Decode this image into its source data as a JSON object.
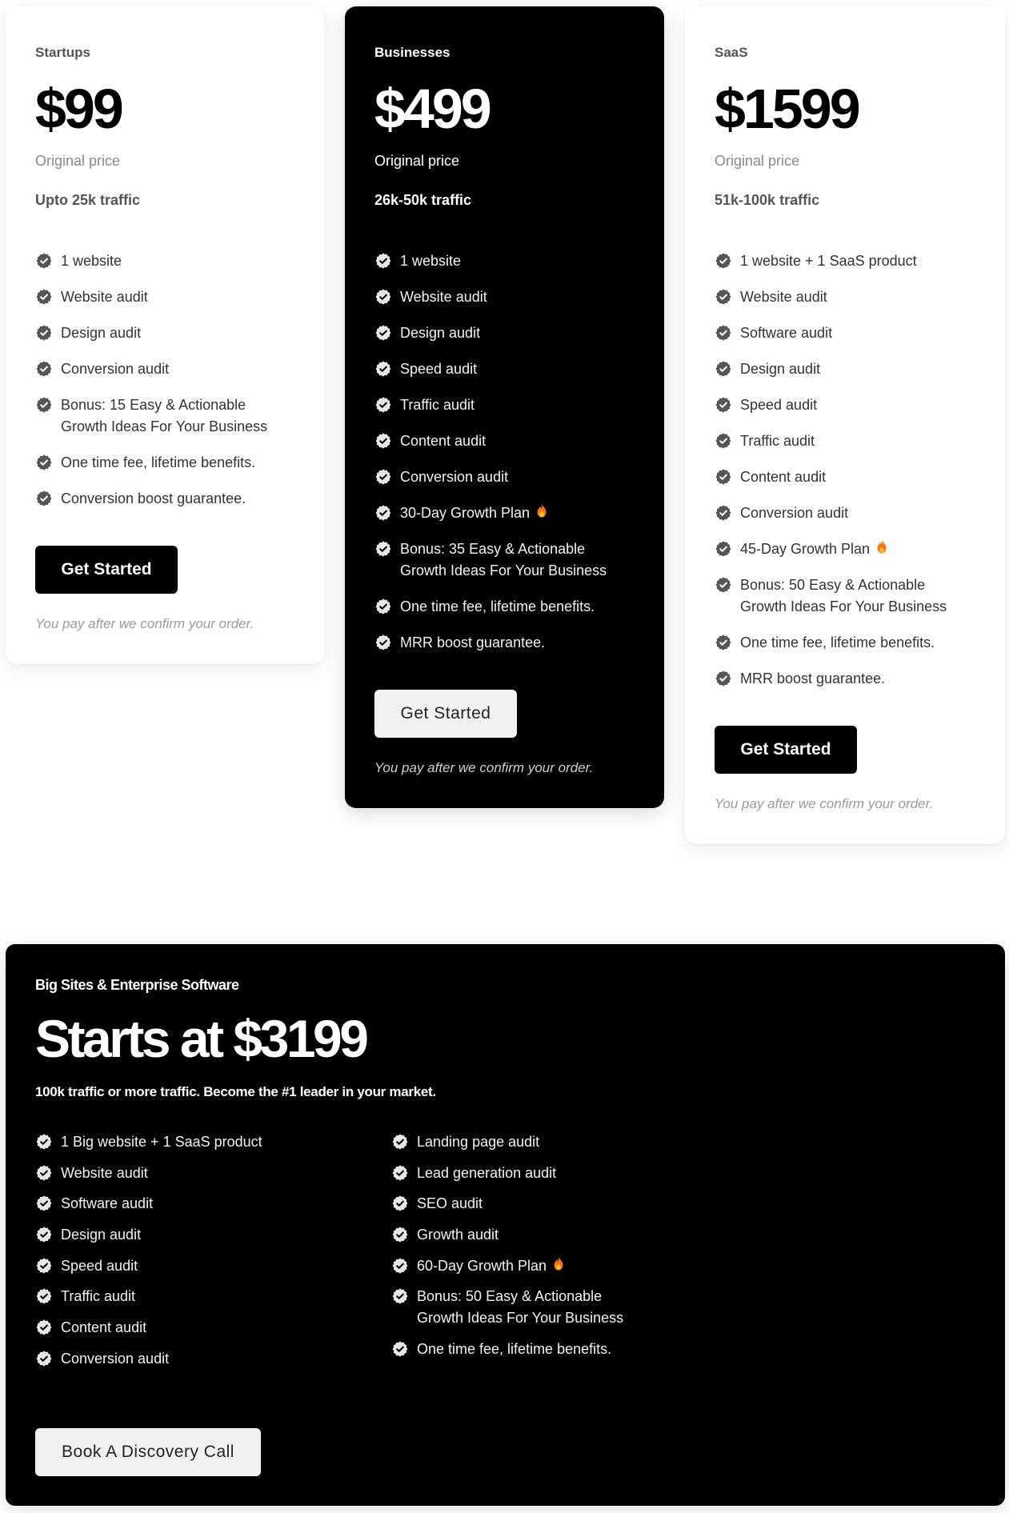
{
  "plans": [
    {
      "name": "Startups",
      "price": "$99",
      "price_note": "Original price",
      "traffic": "Upto 25k traffic",
      "theme": "light",
      "features": [
        {
          "text": "1 website"
        },
        {
          "text": "Website audit"
        },
        {
          "text": "Design audit"
        },
        {
          "text": "Conversion audit"
        },
        {
          "text": "Bonus: 15 Easy & Actionable Growth Ideas For Your Business"
        },
        {
          "text": "One time fee, lifetime benefits."
        },
        {
          "text": "Conversion boost guarantee."
        }
      ],
      "cta_label": "Get Started",
      "footnote": "You pay after we confirm your order."
    },
    {
      "name": "Businesses",
      "price": "$499",
      "price_note": "Original price",
      "traffic": "26k-50k traffic",
      "theme": "dark",
      "features": [
        {
          "text": "1 website"
        },
        {
          "text": "Website audit"
        },
        {
          "text": "Design audit"
        },
        {
          "text": "Speed audit"
        },
        {
          "text": "Traffic audit"
        },
        {
          "text": "Content audit"
        },
        {
          "text": "Conversion audit"
        },
        {
          "text": "30-Day Growth Plan",
          "icon": "fire-icon"
        },
        {
          "text": "Bonus: 35 Easy & Actionable Growth Ideas For Your Business"
        },
        {
          "text": "One time fee, lifetime benefits."
        },
        {
          "text": "MRR boost guarantee."
        }
      ],
      "cta_label": "Get Started",
      "footnote": "You pay after we confirm your order."
    },
    {
      "name": "SaaS",
      "price": "$1599",
      "price_note": "Original price",
      "traffic": "51k-100k traffic",
      "theme": "light",
      "features": [
        {
          "text": "1 website + 1 SaaS product"
        },
        {
          "text": "Website audit"
        },
        {
          "text": "Software audit"
        },
        {
          "text": "Design audit"
        },
        {
          "text": "Speed audit"
        },
        {
          "text": "Traffic audit"
        },
        {
          "text": "Content audit"
        },
        {
          "text": "Conversion audit"
        },
        {
          "text": "45-Day Growth Plan",
          "icon": "fire-icon"
        },
        {
          "text": "Bonus: 50 Easy & Actionable Growth Ideas For Your Business"
        },
        {
          "text": "One time fee, lifetime benefits."
        },
        {
          "text": "MRR boost guarantee."
        }
      ],
      "cta_label": "Get Started",
      "footnote": "You pay after we confirm your order."
    }
  ],
  "enterprise": {
    "label": "Big Sites & Enterprise Software",
    "title": "Starts at $3199",
    "subtitle": "100k traffic or more traffic. Become the #1 leader in your market.",
    "features_left": [
      {
        "text": "1 Big website + 1 SaaS product"
      },
      {
        "text": "Website audit"
      },
      {
        "text": "Software audit"
      },
      {
        "text": "Design audit"
      },
      {
        "text": "Speed audit"
      },
      {
        "text": "Traffic audit"
      },
      {
        "text": "Content audit"
      },
      {
        "text": "Conversion audit"
      }
    ],
    "features_right": [
      {
        "text": "Landing page audit"
      },
      {
        "text": "Lead generation audit"
      },
      {
        "text": "SEO audit"
      },
      {
        "text": "Growth audit"
      },
      {
        "text": "60-Day Growth Plan",
        "icon": "fire-icon"
      },
      {
        "text": "Bonus: 50 Easy & Actionable Growth Ideas For Your Business"
      },
      {
        "text": "One time fee, lifetime benefits."
      }
    ],
    "cta_label": "Book A Discovery Call"
  },
  "icons": {
    "feature_bullet": "badge-check-icon",
    "highlight": "fire-icon"
  },
  "colors": {
    "dark_bg": "#000000",
    "light_bg": "#ffffff",
    "badge_light": "#555555",
    "badge_dark": "#e6e6e6",
    "flame": "#f97316",
    "muted_text": "#8a8a8a"
  }
}
